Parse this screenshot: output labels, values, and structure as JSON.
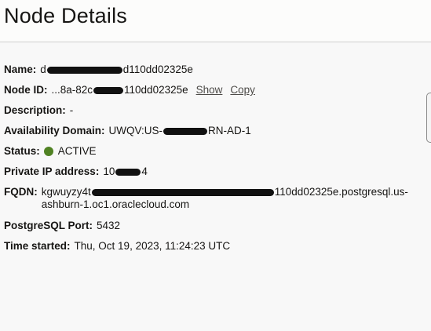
{
  "page": {
    "title": "Node Details"
  },
  "details": {
    "name": {
      "label": "Name:",
      "prefix": "d",
      "suffix": "d110dd02325e"
    },
    "node_id": {
      "label": "Node ID:",
      "prefix": "...8a-82c",
      "suffix": "110dd02325e",
      "show_label": "Show",
      "copy_label": "Copy"
    },
    "description": {
      "label": "Description:",
      "value": "-"
    },
    "availability_domain": {
      "label": "Availability Domain:",
      "prefix": "UWQV:US-",
      "suffix": "RN-AD-1"
    },
    "status": {
      "label": "Status:",
      "value": "ACTIVE",
      "color": "#508223"
    },
    "private_ip": {
      "label": "Private IP address:",
      "prefix": "10",
      "suffix": "4"
    },
    "fqdn": {
      "label": "FQDN:",
      "prefix": "kgwuyzy4t",
      "suffix": "110dd02325e.postgresql.us-ashburn-1.oc1.oraclecloud.com"
    },
    "postgresql_port": {
      "label": "PostgreSQL Port:",
      "value": "5432"
    },
    "time_started": {
      "label": "Time started:",
      "value": "Thu, Oct 19, 2023, 11:24:23 UTC"
    }
  }
}
